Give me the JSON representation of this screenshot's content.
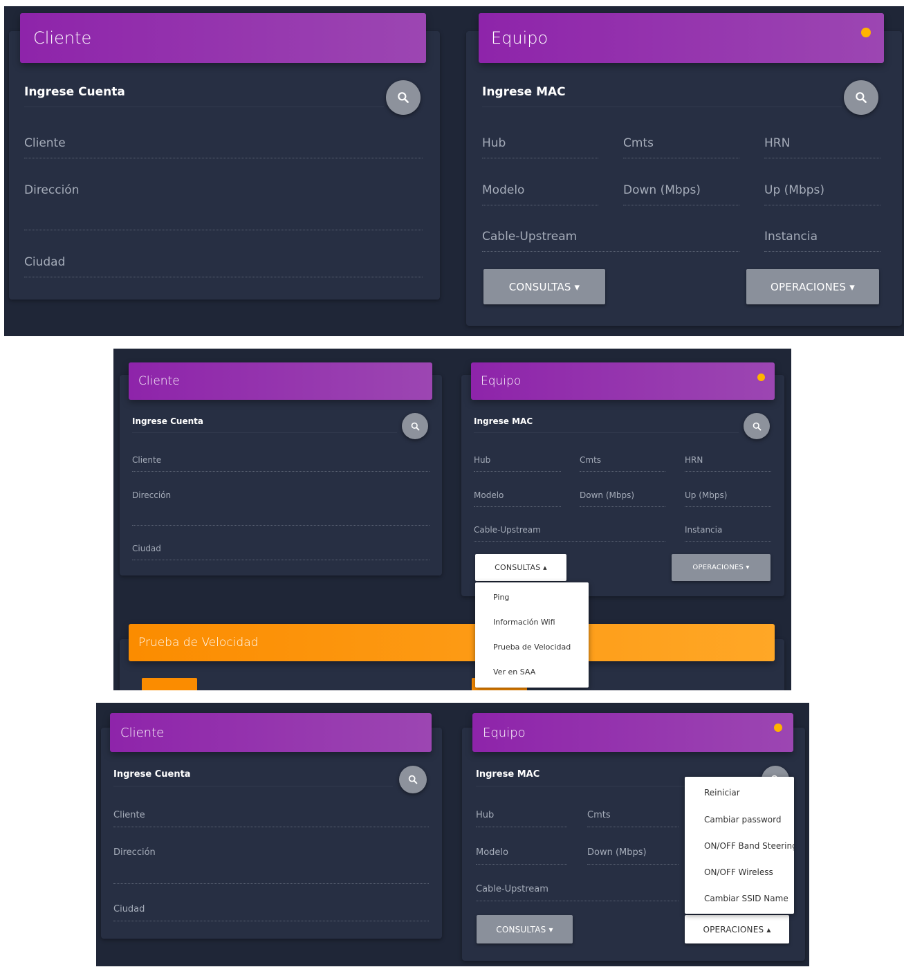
{
  "colors": {
    "background": "#1f2637",
    "card": "#272f43",
    "header_purple": "#8e24aa",
    "header_orange": "#fb8c00",
    "status_dot": "#ffb300",
    "button_gray": "#8a909b",
    "menu_bg": "#ffffff"
  },
  "cliente": {
    "title": "Cliente",
    "account_label": "Ingrese Cuenta",
    "fields": {
      "cliente": "Cliente",
      "direccion": "Dirección",
      "ciudad": "Ciudad"
    }
  },
  "equipo": {
    "title": "Equipo",
    "mac_label": "Ingrese MAC",
    "fields": {
      "hub": "Hub",
      "cmts": "Cmts",
      "hrn": "HRN",
      "modelo": "Modelo",
      "down": "Down (Mbps)",
      "up": "Up (Mbps)",
      "cable_upstream": "Cable-Upstream",
      "instancia": "Instancia"
    },
    "status_indicator": "status-dot"
  },
  "buttons": {
    "consultas": "CONSULTAS",
    "operaciones": "OPERACIONES",
    "caret_down": "▾",
    "caret_up": "▴"
  },
  "consultas_menu": [
    "Ping",
    "Información Wifi",
    "Prueba de Velocidad",
    "Ver en SAA"
  ],
  "operaciones_menu": [
    "Reiniciar",
    "Cambiar password",
    "ON/OFF Band Steering",
    "ON/OFF Wireless",
    "Cambiar SSID Name"
  ],
  "speed_test": {
    "title": "Prueba de Velocidad"
  },
  "icons": {
    "search": "search-icon"
  }
}
